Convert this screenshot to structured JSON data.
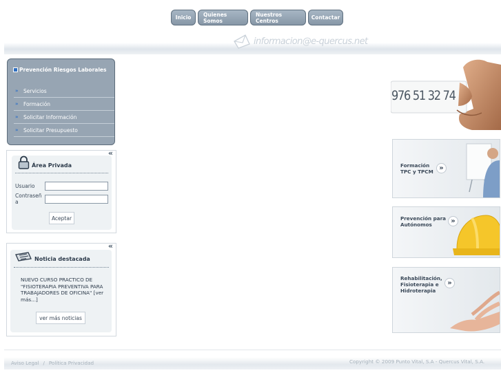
{
  "nav": {
    "items": [
      {
        "label": "Inicio"
      },
      {
        "label": "Quienes Somos"
      },
      {
        "label": "Nuestros Centros"
      },
      {
        "label": "Contactar"
      }
    ]
  },
  "header": {
    "email": "informacion@e-quercus.net"
  },
  "sidebar": {
    "title": "Prevención Riesgos Laborales",
    "items": [
      {
        "label": "Servicios"
      },
      {
        "label": "Formación"
      },
      {
        "label": "Solicitar Información"
      },
      {
        "label": "Solicitar Presupuesto"
      }
    ]
  },
  "private_area": {
    "title": "Área Privada",
    "user_label": "Usuario",
    "password_label": "Contraseña",
    "user_value": "",
    "password_value": "",
    "submit_label": "Aceptar",
    "collapse_icon": "«"
  },
  "news": {
    "title": "Noticia destacada",
    "body": "NUEVO CURSO PRACTICO DE \"FISIOTERAPIA PREVENTIVA PARA TRABAJADORES DE OFICINA\" [ver más...]",
    "more_label": "ver más noticias",
    "collapse_icon": "«"
  },
  "phone_card": {
    "number": "976 51 32 74"
  },
  "promos": [
    {
      "line1": "Formación",
      "line2": "TPC y TPCM",
      "line3": ""
    },
    {
      "line1": "Prevención para",
      "line2": "Autónomos",
      "line3": ""
    },
    {
      "line1": "Rehabilitación,",
      "line2": "Fisioterapia e",
      "line3": "Hidroterapia"
    }
  ],
  "footer": {
    "legal": "Aviso Legal",
    "separator": "/",
    "privacy": "Política Privacidad",
    "copyright": "Copyright © 2009 Punto Vital, S.A - Quercus Vital, S.A."
  }
}
